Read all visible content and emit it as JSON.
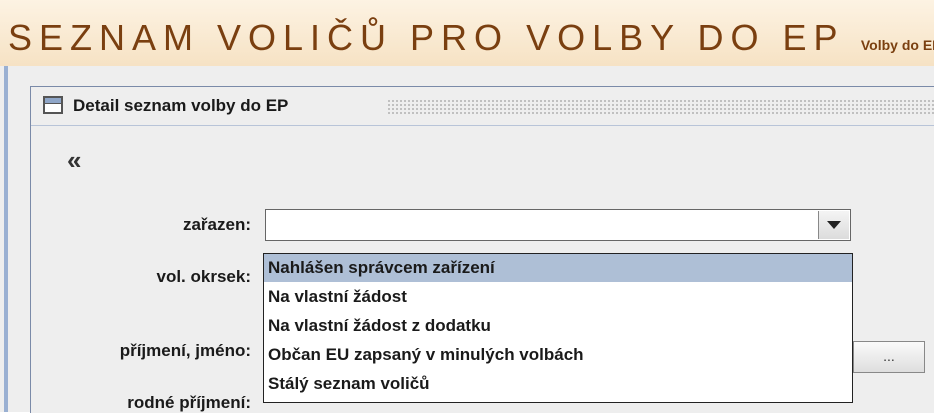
{
  "header": {
    "title": "SEZNAM VOLIČŮ PRO VOLBY DO EP",
    "subtitle": "Volby do EP :"
  },
  "panel": {
    "title": "Detail seznam volby do EP"
  },
  "nav": {
    "back_glyph": "«"
  },
  "form": {
    "zarazen_label": "zařazen:",
    "okrsek_label": "vol. okrsek:",
    "prijmeni_label": "příjmení, jméno:",
    "rodne_label": "rodné příjmení:",
    "zarazen_value": "",
    "ellipsis_label": "..."
  },
  "dropdown": {
    "options": [
      "Nahlášen správcem zařízení",
      "Na vlastní žádost",
      "Na vlastní žádost z dodatku",
      "Občan EU zapsaný v minulých volbách",
      "Stálý seznam voličů"
    ],
    "selected_index": 0
  },
  "colors": {
    "header_text": "#7a3f10",
    "selected_row": "#aebfd6"
  }
}
